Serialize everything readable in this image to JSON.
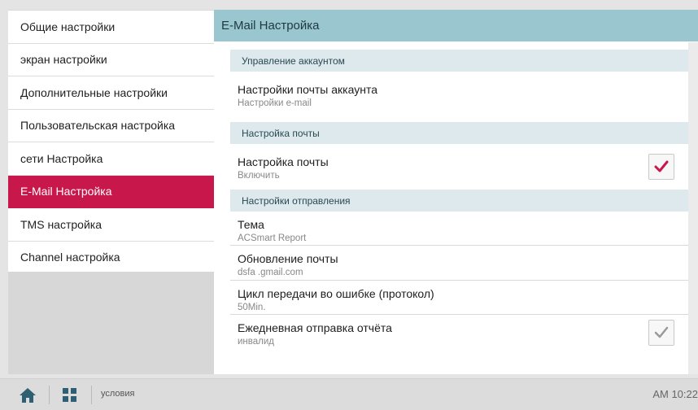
{
  "sidebar": {
    "items": [
      {
        "label": "Общие настройки"
      },
      {
        "label": "экран настройки"
      },
      {
        "label": "Дополнительные настройки"
      },
      {
        "label": "Пользовательская настройка"
      },
      {
        "label": "сети Настройка"
      },
      {
        "label": "E-Mail Настройка",
        "active": true
      },
      {
        "label": "TMS настройка"
      },
      {
        "label": "Channel настройка"
      }
    ]
  },
  "main": {
    "title": "E-Mail Настройка",
    "sections": [
      {
        "header": "Управление аккаунтом",
        "rows": [
          {
            "title": "Настройки почты аккаунта",
            "subtitle": "Настройки e-mail"
          }
        ]
      },
      {
        "header": "Настройка почты",
        "rows": [
          {
            "title": "Настройка почты",
            "subtitle": "Включить",
            "checkbox": "checked"
          }
        ]
      },
      {
        "header": "Настройки отправления",
        "rows": [
          {
            "title": "Тема",
            "subtitle": "ACSmart Report"
          },
          {
            "title": "Обновление почты",
            "subtitle": "dsfa .gmail.com"
          },
          {
            "title": "Цикл передачи во ошибке (протокол)",
            "subtitle": "50Min."
          },
          {
            "title": "Ежедневная отправка отчёта",
            "subtitle": "инвалид",
            "checkbox": "disabled"
          }
        ]
      }
    ]
  },
  "bottom_bar": {
    "home_icon": "home-icon",
    "apps_icon": "grid-icon",
    "label": "условия",
    "time": "AM 10:22"
  },
  "colors": {
    "accent": "#c8174a",
    "header_bg": "#9ac6cf",
    "section_bg": "#dde9ec",
    "check_active": "#c8174a",
    "check_disabled": "#9a9a9a"
  }
}
